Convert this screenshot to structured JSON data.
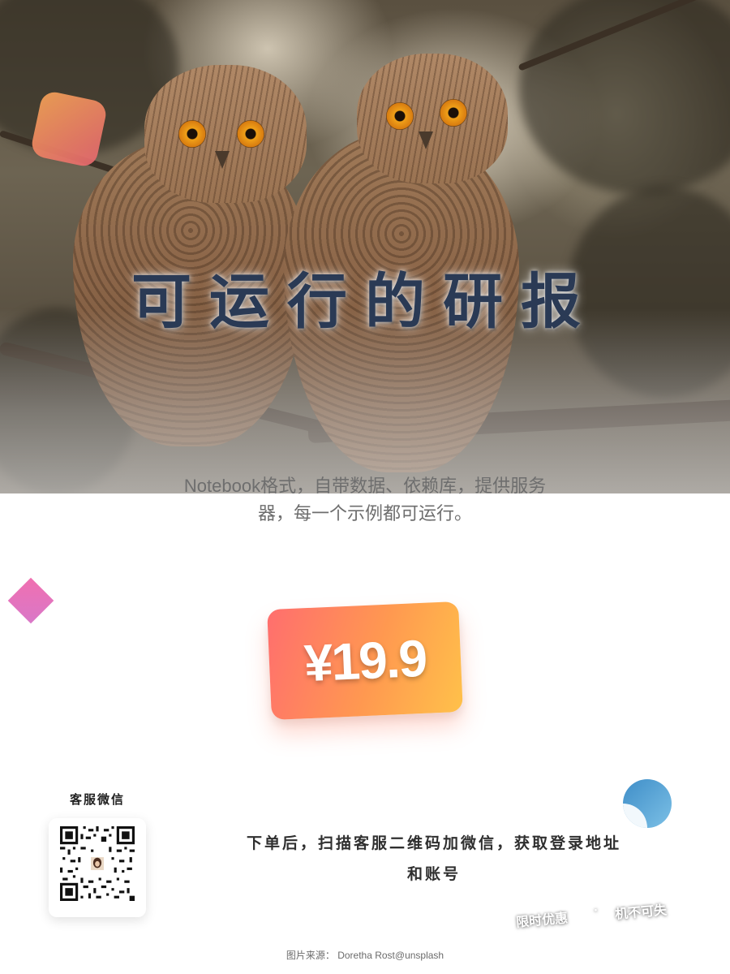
{
  "hero": {
    "title": "可运行的研报",
    "subtitle": "Notebook格式，自带数据、依赖库，提供服务器，每一个示例都可运行。"
  },
  "price": {
    "label": "¥19.9"
  },
  "customer_service": {
    "label": "客服微信"
  },
  "instructions": "下单后，扫描客服二维码加微信，获取登录地址和账号",
  "promo": {
    "left": "限时优惠",
    "separator": "·",
    "right": "机不可失"
  },
  "credit": "图片来源： Doretha Rost@unsplash",
  "colors": {
    "title": "#2a3a55",
    "price_gradient_start": "#ff6e6e",
    "price_gradient_end": "#ffc14a",
    "deco_square": "#f5a356",
    "deco_diamond": "#f06fb0",
    "deco_circle": "#3f8ec8"
  }
}
